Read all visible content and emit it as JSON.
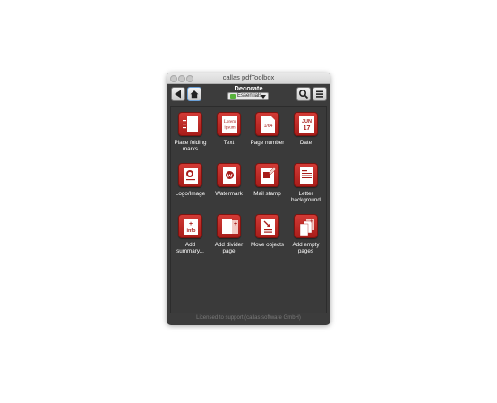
{
  "window": {
    "title": "callas pdfToolbox"
  },
  "toolbar": {
    "section_title": "Decorate",
    "library_select": "Essentials",
    "back_icon": "back-triangle-icon",
    "home_icon": "home-icon",
    "search_icon": "search-icon",
    "menu_icon": "list-menu-icon"
  },
  "colors": {
    "tile": "#c0302b",
    "background": "#3c3c3c",
    "accent_border": "#6aa0d8"
  },
  "items": [
    {
      "label": "Place folding marks",
      "icon": "folding-marks-icon"
    },
    {
      "label": "Text",
      "icon": "lorem-ipsum-icon",
      "icon_text1": "Lorem",
      "icon_text2": "ipsum"
    },
    {
      "label": "Page number",
      "icon": "page-number-icon",
      "icon_text1": "1/64"
    },
    {
      "label": "Date",
      "icon": "calendar-icon",
      "icon_text1": "JUN",
      "icon_text2": "17"
    },
    {
      "label": "Logo/Image",
      "icon": "logo-image-icon"
    },
    {
      "label": "Watermark",
      "icon": "watermark-icon"
    },
    {
      "label": "Mail stamp",
      "icon": "mail-stamp-icon"
    },
    {
      "label": "Letter background",
      "icon": "letter-background-icon"
    },
    {
      "label": "Add summary...",
      "icon": "add-summary-icon",
      "icon_text1": "info"
    },
    {
      "label": "Add divider page",
      "icon": "add-divider-page-icon"
    },
    {
      "label": "Move objects",
      "icon": "move-objects-icon"
    },
    {
      "label": "Add empty pages",
      "icon": "add-empty-pages-icon"
    }
  ],
  "footer": {
    "license": "Licensed to support (callas software GmbH)"
  }
}
